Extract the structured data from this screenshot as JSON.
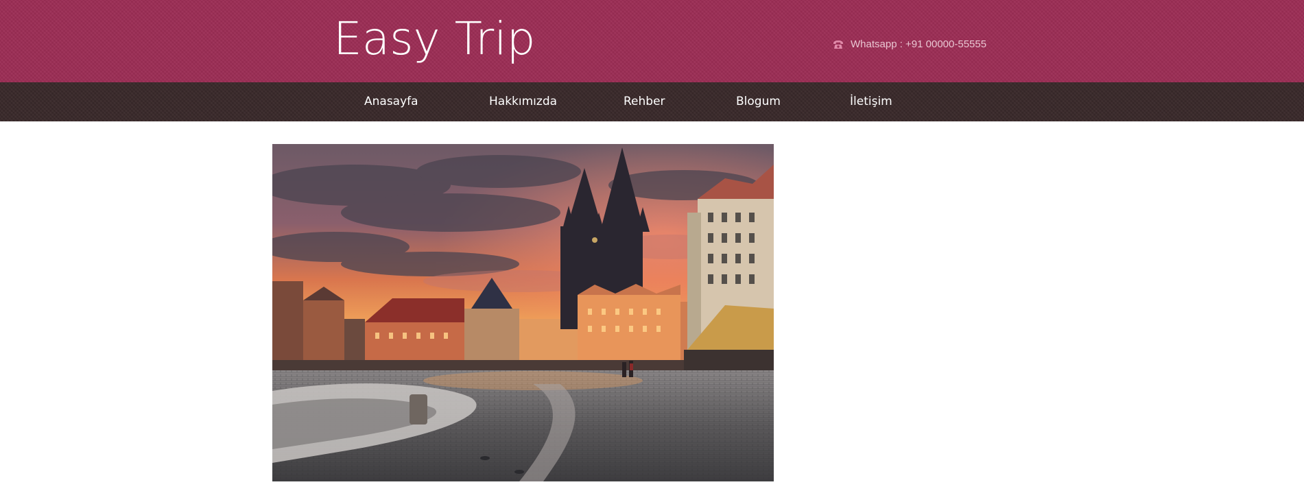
{
  "header": {
    "logo_text": "Easy Trip",
    "contact_text": "Whatsapp : +91 00000-55555",
    "contact_icon": "phone-icon"
  },
  "nav": {
    "items": [
      {
        "label": "Anasayfa"
      },
      {
        "label": "Hakkımızda"
      },
      {
        "label": "Rehber"
      },
      {
        "label": "Blogum"
      },
      {
        "label": "İletişim"
      }
    ]
  },
  "hero": {
    "image_subject": "Prague Old Town Square at sunset"
  },
  "colors": {
    "header_bg": "#9c2d55",
    "nav_bg": "#3a2a2b",
    "logo_text": "#ffffff",
    "contact_text": "#e9c6d2",
    "nav_text": "#ffffff",
    "page_bg": "#ffffff"
  }
}
